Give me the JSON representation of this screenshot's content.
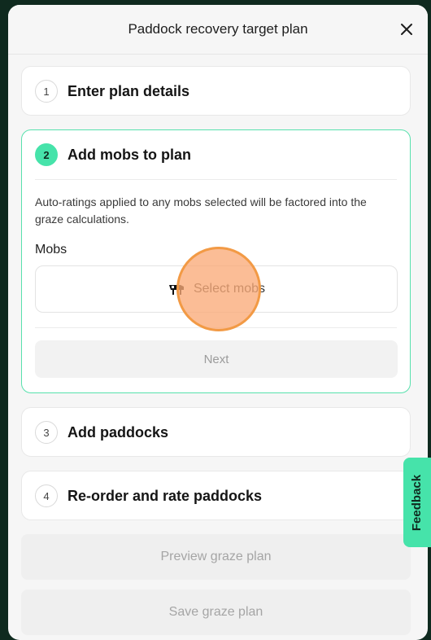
{
  "modal": {
    "title": "Paddock recovery target plan",
    "close_icon": "close-icon"
  },
  "steps": [
    {
      "number": "1",
      "title": "Enter plan details"
    },
    {
      "number": "2",
      "title": "Add mobs to plan"
    },
    {
      "number": "3",
      "title": "Add paddocks"
    },
    {
      "number": "4",
      "title": "Re-order and rate paddocks"
    }
  ],
  "active_step": {
    "description": "Auto-ratings applied to any mobs selected will be factored into the graze calculations.",
    "mobs_label": "Mobs",
    "select_mobs_label": "Select mobs",
    "select_mobs_icon": "cow-icon",
    "next_label": "Next"
  },
  "footer": {
    "preview_label": "Preview graze plan",
    "save_label": "Save graze plan"
  },
  "feedback_label": "Feedback",
  "colors": {
    "accent": "#46e3aa",
    "background": "#0f2a1f",
    "click_indicator": "#f29a45"
  }
}
